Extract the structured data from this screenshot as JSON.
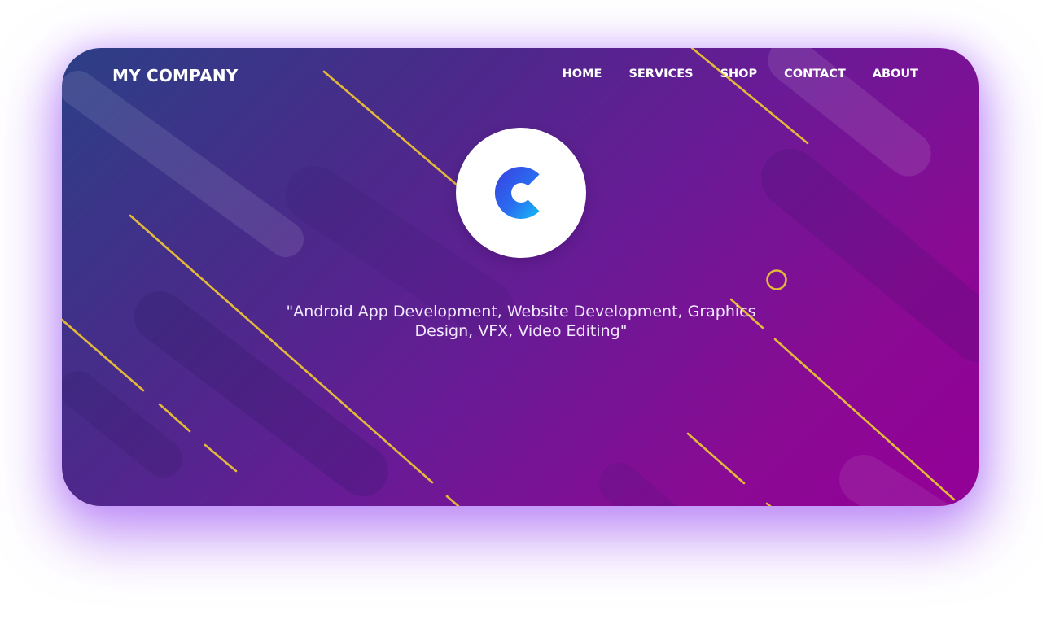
{
  "brand": {
    "name": "MY COMPANY"
  },
  "nav": {
    "items": [
      {
        "label": "HOME"
      },
      {
        "label": "SERVICES"
      },
      {
        "label": "SHOP"
      },
      {
        "label": "CONTACT"
      },
      {
        "label": "ABOUT"
      }
    ]
  },
  "hero": {
    "logo_icon": "letter-c-logo-icon",
    "tagline": "\"Android App Development, Website Development, Graphics Design, VFX, Video Editing\""
  },
  "colors": {
    "gradient_start": "#2c3f86",
    "gradient_end": "#930096",
    "accent_line": "#e2b93b",
    "logo_blue_start": "#2f55e6",
    "logo_blue_end": "#18b6f5",
    "shadow_glow": "#9646f0"
  }
}
